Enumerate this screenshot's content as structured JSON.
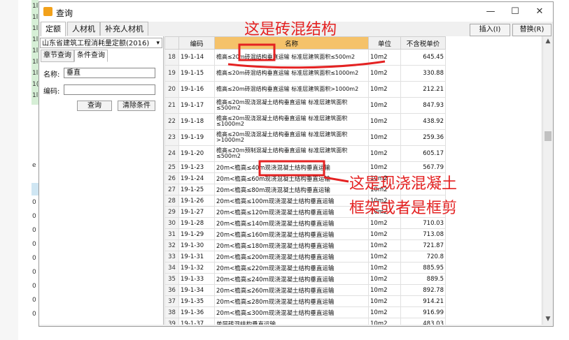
{
  "window": {
    "title": "查询",
    "minimize_glyph": "—",
    "maximize_glyph": "☐",
    "close_glyph": "✕"
  },
  "tabs": [
    {
      "label": "定额",
      "active": true
    },
    {
      "label": "人材机",
      "active": false
    },
    {
      "label": "补充人材机",
      "active": false
    }
  ],
  "buttons": {
    "insert": "插入(I)",
    "replace": "替换(R)"
  },
  "left": {
    "quota_book": "山东省建筑工程消耗量定额(2016)",
    "subtabs": [
      "章节查询",
      "条件查询"
    ],
    "name_label": "名称:",
    "name_value": "垂直",
    "code_label": "编码:",
    "code_value": "",
    "search_button": "查询",
    "clear_button": "清除条件"
  },
  "grid": {
    "columns": [
      "",
      "编码",
      "名称",
      "单位",
      "不含税单价"
    ],
    "rows": [
      {
        "n": "18",
        "code": "19-1-14",
        "name": "檐高≤20m砖混结构垂直运输 标准层建筑面积≤500m2",
        "unit": "10m2",
        "price": "645.45"
      },
      {
        "n": "19",
        "code": "19-1-15",
        "name": "檐高≤20m砖混结构垂直运输 标准层建筑面积≤1000m2",
        "unit": "10m2",
        "price": "330.88"
      },
      {
        "n": "20",
        "code": "19-1-16",
        "name": "檐高≤20m砖混结构垂直运输 标准层建筑面积>1000m2",
        "unit": "10m2",
        "price": "212.21"
      },
      {
        "n": "21",
        "code": "19-1-17",
        "name": "檐高≤20m现浇混凝土结构垂直运输 标准层建筑面积≤500m2",
        "unit": "10m2",
        "price": "847.93"
      },
      {
        "n": "22",
        "code": "19-1-18",
        "name": "檐高≤20m现浇混凝土结构垂直运输 标准层建筑面积≤1000m2",
        "unit": "10m2",
        "price": "438.92"
      },
      {
        "n": "23",
        "code": "19-1-19",
        "name": "檐高≤20m现浇混凝土结构垂直运输 标准层建筑面积>1000m2",
        "unit": "10m2",
        "price": "259.36"
      },
      {
        "n": "24",
        "code": "19-1-20",
        "name": "檐高≤20m预制混凝土结构垂直运输 标准层建筑面积≤500m2",
        "unit": "10m2",
        "price": "605.17"
      },
      {
        "n": "25",
        "code": "19-1-23",
        "name": "20m<檐高≤40m现浇混凝土结构垂直运输",
        "unit": "10m2",
        "price": "567.79"
      },
      {
        "n": "26",
        "code": "19-1-24",
        "name": "20m<檐高≤60m现浇混凝土结构垂直运输",
        "unit": "10m2",
        "price": ""
      },
      {
        "n": "27",
        "code": "19-1-25",
        "name": "20m<檐高≤80m现浇混凝土结构垂直运输",
        "unit": "10m2",
        "price": ""
      },
      {
        "n": "28",
        "code": "19-1-26",
        "name": "20m<檐高≤100m现浇混凝土结构垂直运输",
        "unit": "10m2",
        "price": ""
      },
      {
        "n": "29",
        "code": "19-1-27",
        "name": "20m<檐高≤120m现浇混凝土结构垂直运输",
        "unit": "10m2",
        "price": ""
      },
      {
        "n": "30",
        "code": "19-1-28",
        "name": "20m<檐高≤140m现浇混凝土结构垂直运输",
        "unit": "10m2",
        "price": "710.03"
      },
      {
        "n": "31",
        "code": "19-1-29",
        "name": "20m<檐高≤160m现浇混凝土结构垂直运输",
        "unit": "10m2",
        "price": "713.08"
      },
      {
        "n": "32",
        "code": "19-1-30",
        "name": "20m<檐高≤180m现浇混凝土结构垂直运输",
        "unit": "10m2",
        "price": "721.87"
      },
      {
        "n": "33",
        "code": "19-1-31",
        "name": "20m<檐高≤200m现浇混凝土结构垂直运输",
        "unit": "10m2",
        "price": "720.8"
      },
      {
        "n": "34",
        "code": "19-1-32",
        "name": "20m<檐高≤220m现浇混凝土结构垂直运输",
        "unit": "10m2",
        "price": "885.95"
      },
      {
        "n": "35",
        "code": "19-1-33",
        "name": "20m<檐高≤240m现浇混凝土结构垂直运输",
        "unit": "10m2",
        "price": "889.5"
      },
      {
        "n": "36",
        "code": "19-1-34",
        "name": "20m<檐高≤260m现浇混凝土结构垂直运输",
        "unit": "10m2",
        "price": "892.78"
      },
      {
        "n": "37",
        "code": "19-1-35",
        "name": "20m<檐高≤280m现浇混凝土结构垂直运输",
        "unit": "10m2",
        "price": "914.21"
      },
      {
        "n": "38",
        "code": "19-1-36",
        "name": "20m<檐高≤300m现浇混凝土结构垂直运输",
        "unit": "10m2",
        "price": "916.99"
      },
      {
        "n": "39",
        "code": "19-1-37",
        "name": "单层砖混结构垂直运输",
        "unit": "10m2",
        "price": "483.03"
      }
    ]
  },
  "annotations": {
    "top": "这是砖混结构",
    "right_line1": "这是现浇混凝土",
    "right_line2": "框架或者是框剪",
    "color": "#e42222"
  },
  "left_strip": [
    "1l",
    "1l",
    "1l",
    "1l",
    "1l",
    "1l",
    "1l",
    "1(",
    "1l",
    "e",
    "0",
    "0",
    "0",
    "0",
    "0",
    "0",
    "0",
    "0",
    "0",
    "0",
    "0",
    "0"
  ]
}
